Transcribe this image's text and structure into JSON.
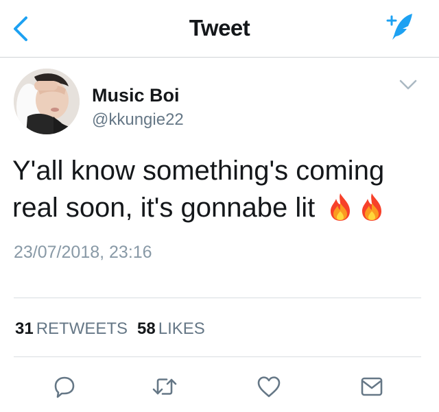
{
  "header": {
    "title": "Tweet",
    "back_icon": "chevron-left-icon",
    "compose_icon": "compose-tweet-icon",
    "accent_color": "#1da1f2"
  },
  "tweet": {
    "author": {
      "name": "Music Boi",
      "handle": "@kkungie22"
    },
    "text": "Y'all know something's coming real soon, it's gonnabe lit",
    "emojis": [
      "fire-emoji",
      "fire-emoji"
    ],
    "timestamp": "23/07/2018, 23:16"
  },
  "stats": {
    "retweets_count": "31",
    "retweets_label": "RETWEETS",
    "likes_count": "58",
    "likes_label": "LIKES"
  },
  "actions": [
    "reply-icon",
    "retweet-icon",
    "like-icon",
    "direct-message-icon"
  ]
}
